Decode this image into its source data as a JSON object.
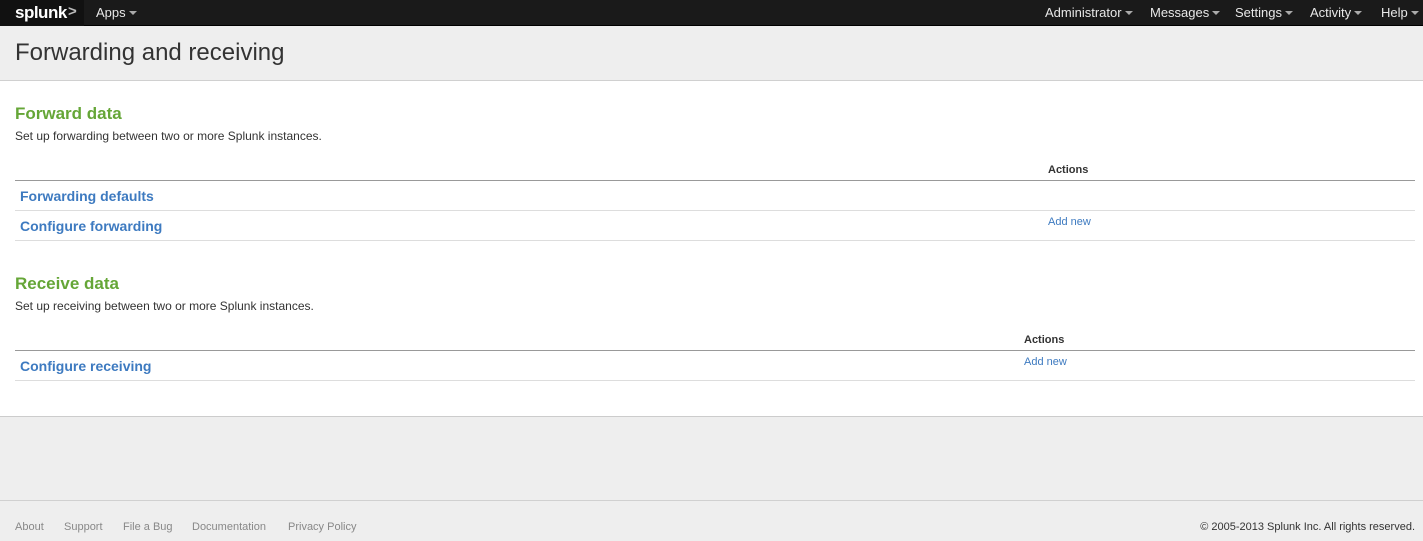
{
  "topbar": {
    "logo": "splunk",
    "logo_mark": ">",
    "apps_label": "Apps",
    "right_menu": [
      "Administrator",
      "Messages",
      "Settings",
      "Activity",
      "Help"
    ]
  },
  "page": {
    "title": "Forwarding and receiving"
  },
  "forward": {
    "title": "Forward data",
    "description": "Set up forwarding between two or more Splunk instances.",
    "actions_header": "Actions",
    "rows": [
      {
        "label": "Forwarding defaults",
        "action": ""
      },
      {
        "label": "Configure forwarding",
        "action": "Add new"
      }
    ]
  },
  "receive": {
    "title": "Receive data",
    "description": "Set up receiving between two or more Splunk instances.",
    "actions_header": "Actions",
    "rows": [
      {
        "label": "Configure receiving",
        "action": "Add new"
      }
    ]
  },
  "footer": {
    "links": [
      "About",
      "Support",
      "File a Bug",
      "Documentation",
      "Privacy Policy"
    ],
    "copyright": "© 2005-2013 Splunk Inc. All rights reserved."
  },
  "colors": {
    "section_title": "#65a637",
    "link": "#3d7ac0",
    "topbar": "#1a1a1a"
  }
}
